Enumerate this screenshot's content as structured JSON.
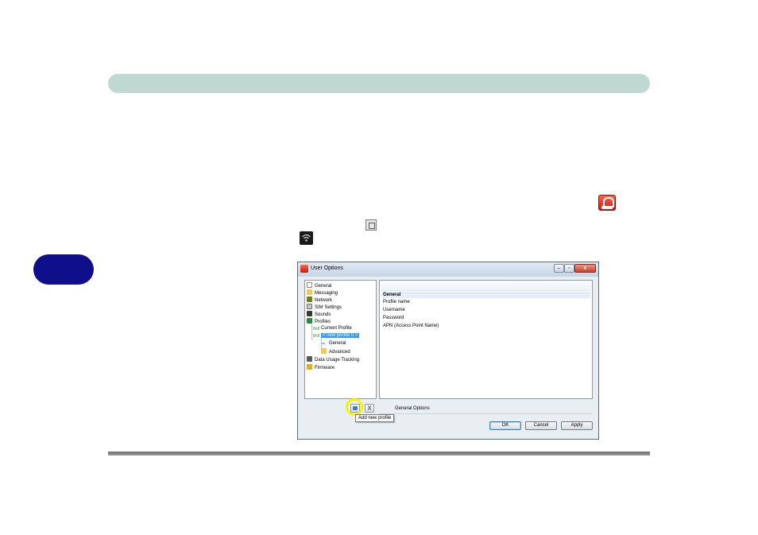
{
  "dialog": {
    "title": "User Options",
    "window_buttons": {
      "minimize": "–",
      "maximize": "▫",
      "close": "x"
    }
  },
  "nav_tree": {
    "items": [
      {
        "label": "General",
        "icon": "document-icon"
      },
      {
        "label": "Messaging",
        "icon": "mail-icon"
      },
      {
        "label": "Network",
        "icon": "network-icon"
      },
      {
        "label": "SIM Settings",
        "icon": "sim-card-icon"
      },
      {
        "label": "Sounds",
        "icon": "speaker-icon"
      },
      {
        "label": "Profiles",
        "icon": "globe-icon"
      },
      {
        "label": "Current Profile",
        "icon": "profile-status-icon",
        "status_glyph": "8n8"
      },
      {
        "label": "< new profile 0 >",
        "icon": "profile-status-icon",
        "status_glyph": "8n8",
        "selected": true
      },
      {
        "label": "General",
        "icon": "arrow-right-icon",
        "glyph": "⇒"
      },
      {
        "label": "Advanced",
        "icon": "folder-icon"
      },
      {
        "label": "Data Usage Tracking",
        "icon": "data-usage-icon"
      },
      {
        "label": "Firmware",
        "icon": "firmware-icon"
      }
    ]
  },
  "content": {
    "rows": [
      "General",
      "Profile name",
      "Username",
      "Password",
      "APN (Access Point Name)"
    ]
  },
  "toolbar": {
    "delete_glyph": "X",
    "tooltip": "Add new profile",
    "status_label": "General Options"
  },
  "buttons": {
    "ok": "OK",
    "cancel": "Cancel",
    "apply": "Apply"
  },
  "colors": {
    "header_bar": "#bfd8d2",
    "chapter_tab": "#0f0f8c",
    "highlight_ring": "#f7f200",
    "selection": "#3399ff"
  }
}
